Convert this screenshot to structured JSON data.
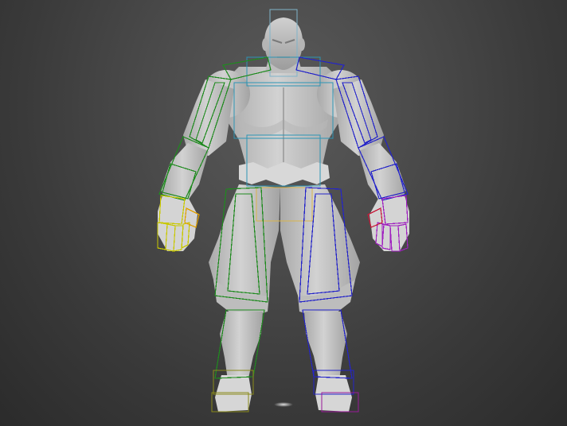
{
  "viewport": {
    "background": "#454545",
    "mesh_color": "#c9c9c9",
    "shade_color": "#9a9a9a"
  },
  "bone_colors": {
    "head": "#7fb3c9",
    "spine": "#2c95b5",
    "pelvis": "#d9b44a",
    "left_arm": "#1f8a1f",
    "right_arm": "#2424c9",
    "left_hand": "#c8c800",
    "right_hand_palm": "#c81a3a",
    "right_hand": "#a020c0",
    "left_leg": "#1f8a1f",
    "right_leg": "#2424c9",
    "left_foot": "#8a8a1a",
    "right_foot": "#9a1a9a"
  }
}
